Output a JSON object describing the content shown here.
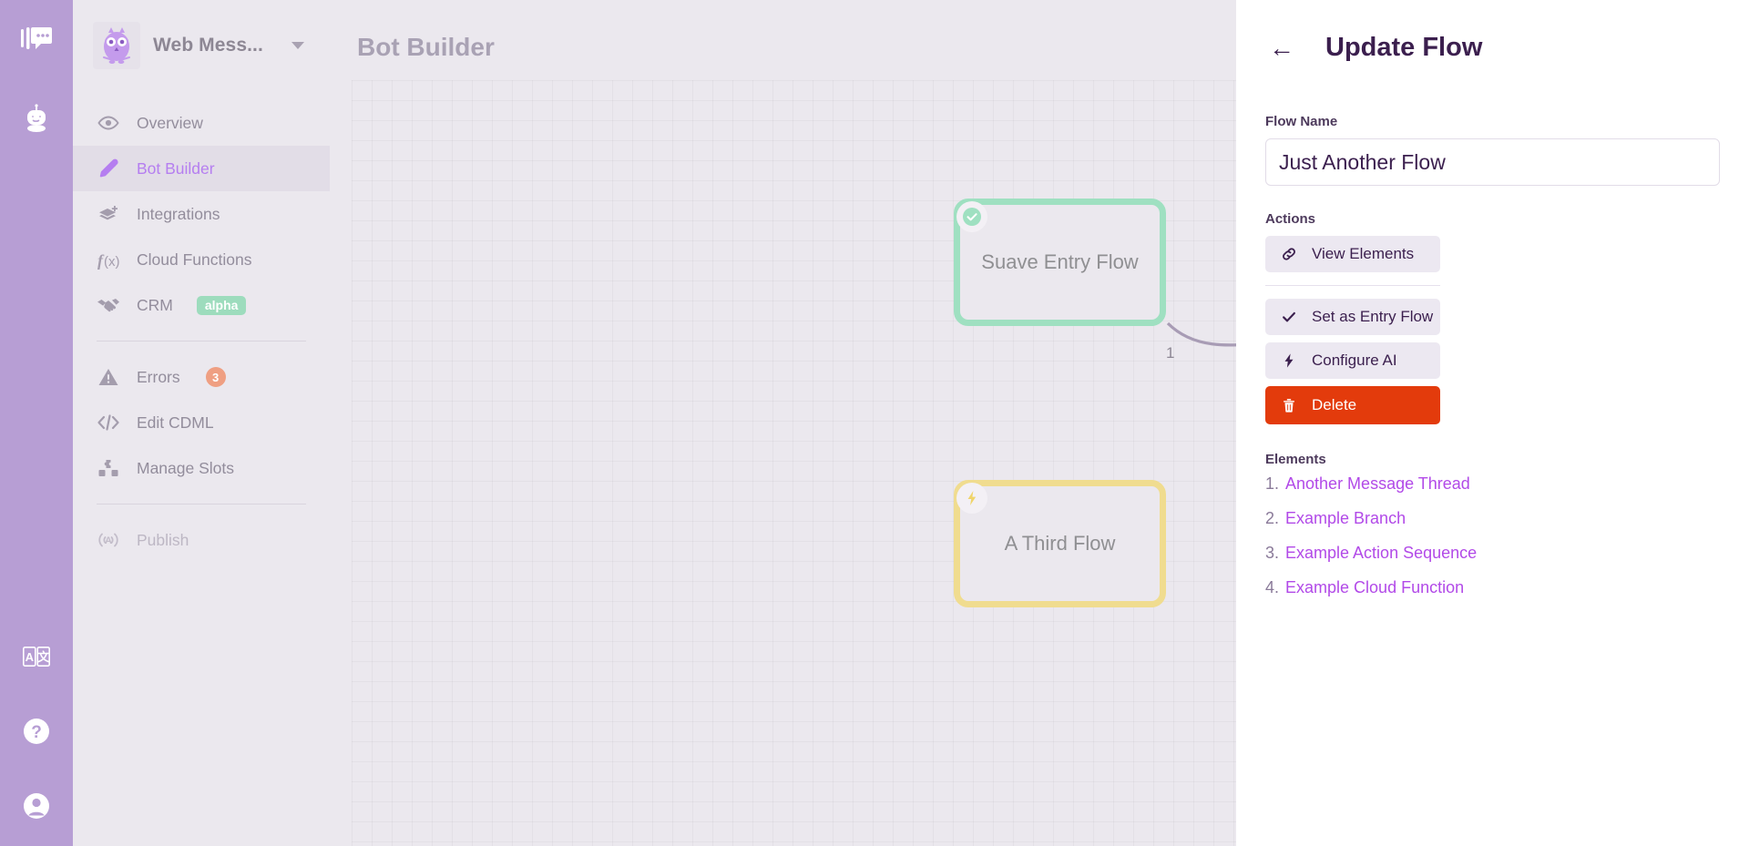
{
  "rail": {
    "top_icons": [
      {
        "name": "messaging-icon",
        "label": "Messaging"
      },
      {
        "name": "bot-icon",
        "label": "Bot"
      }
    ],
    "bottom_icons": [
      {
        "name": "translate-icon",
        "label": "Translate"
      },
      {
        "name": "help-icon",
        "label": "Help"
      },
      {
        "name": "account-icon",
        "label": "Account"
      }
    ]
  },
  "sidebar": {
    "workspace": {
      "name": "Web Mess...",
      "logo_icon": "owl-logo-icon",
      "caret_icon": "chevron-down-icon"
    },
    "items": [
      {
        "label": "Overview",
        "icon": "eye-icon",
        "active": false,
        "muted": false
      },
      {
        "label": "Bot Builder",
        "icon": "pencil-icon",
        "active": true,
        "muted": false
      },
      {
        "label": "Integrations",
        "icon": "layers-icon",
        "active": false,
        "muted": false
      },
      {
        "label": "Cloud Functions",
        "icon": "function-icon",
        "active": false,
        "muted": false
      },
      {
        "label": "CRM",
        "icon": "handshake-icon",
        "active": false,
        "muted": false,
        "badge": "alpha"
      },
      {
        "label": "Errors",
        "icon": "warning-icon",
        "active": false,
        "muted": false,
        "count": "3"
      },
      {
        "label": "Edit CDML",
        "icon": "code-icon",
        "active": false,
        "muted": false
      },
      {
        "label": "Manage Slots",
        "icon": "slots-icon",
        "active": false,
        "muted": false
      },
      {
        "label": "Publish",
        "icon": "broadcast-icon",
        "active": false,
        "muted": true
      }
    ]
  },
  "canvas": {
    "title": "Bot Builder",
    "nodes": [
      {
        "label": "Suave Entry Flow",
        "type": "entry",
        "chip_icon": "check-circle-icon",
        "color": "#9fe0c1"
      },
      {
        "label": "A Third Flow",
        "type": "trigger",
        "chip_icon": "lightning-icon",
        "color": "#f0dc8f"
      },
      {
        "label": "Just Another Flow",
        "type": "selected",
        "chip_icon": "",
        "color": "#c99bee"
      }
    ],
    "edge_label": "1"
  },
  "panel": {
    "back_icon": "arrow-left-icon",
    "title": "Update Flow",
    "flow_name_label": "Flow Name",
    "flow_name_value": "Just Another Flow",
    "flow_name_placeholder": "Flow Name",
    "actions_label": "Actions",
    "actions": [
      {
        "label": "View Elements",
        "icon": "link-icon",
        "style": "default"
      },
      {
        "label": "Set as Entry Flow",
        "icon": "check-icon",
        "style": "default"
      },
      {
        "label": "Configure AI",
        "icon": "lightning-icon",
        "style": "default"
      },
      {
        "label": "Delete",
        "icon": "trash-icon",
        "style": "danger"
      }
    ],
    "elements_label": "Elements",
    "elements": [
      {
        "num": "1.",
        "label": "Another Message Thread"
      },
      {
        "num": "2.",
        "label": "Example Branch"
      },
      {
        "num": "3.",
        "label": "Example Action Sequence"
      },
      {
        "num": "4.",
        "label": "Example Cloud Function"
      }
    ]
  },
  "colors": {
    "rail": "#b79ed4",
    "sidebar": "#ebe8ee",
    "accent": "#b57ef0",
    "danger": "#e33b0c",
    "alpha_badge": "#9ddcbd",
    "error_badge": "#ef9f82",
    "panel_title": "#3b1f4e"
  }
}
